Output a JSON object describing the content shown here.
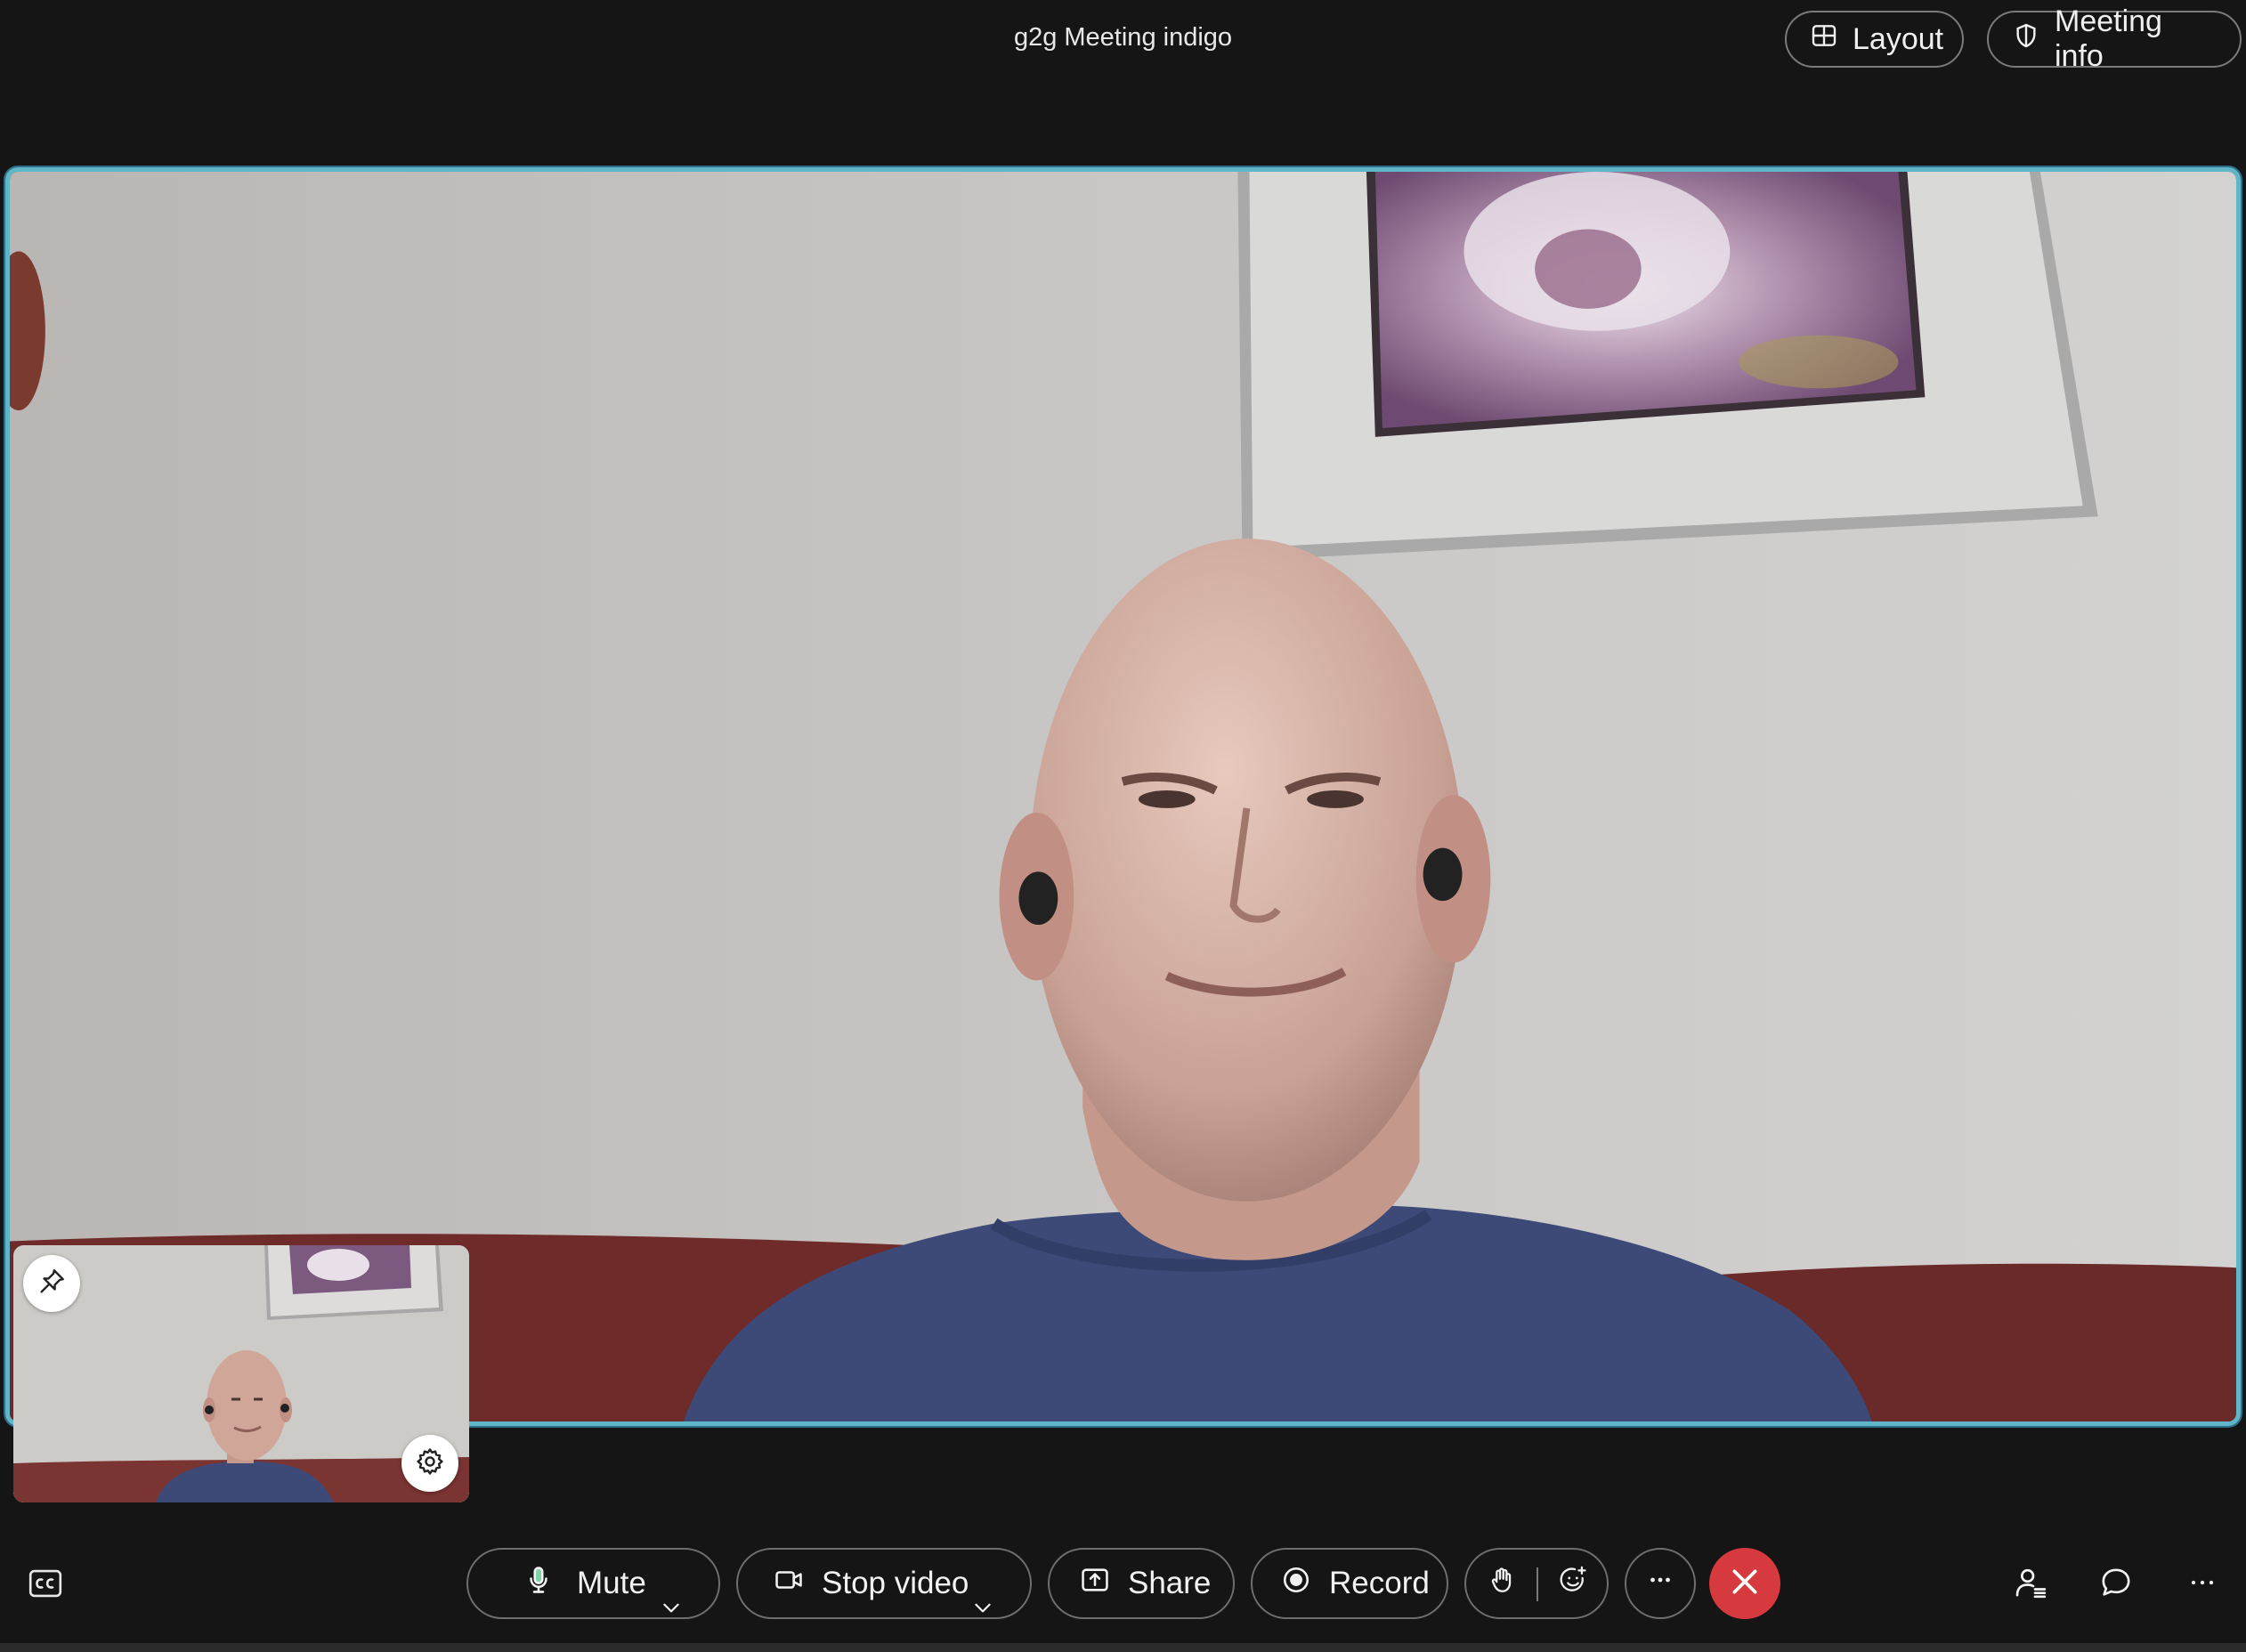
{
  "header": {
    "meeting_title": "g2g Meeting indigo",
    "layout_label": "Layout",
    "meeting_info_label": "Meeting info"
  },
  "main_video": {
    "active_speaker_border_color": "#5fb6c9"
  },
  "self_view": {
    "pin_icon": "pin-icon",
    "settings_icon": "gear-icon"
  },
  "toolbar": {
    "captions_icon": "closed-captions-icon",
    "mute_label": "Mute",
    "stop_video_label": "Stop video",
    "share_label": "Share",
    "record_label": "Record",
    "raise_hand_icon": "raise-hand-icon",
    "reactions_icon": "emoji-reaction-icon",
    "more_icon": "more-horizontal-icon",
    "end_call_icon": "close-icon",
    "participants_icon": "participants-icon",
    "chat_icon": "chat-bubble-icon",
    "overflow_icon": "more-horizontal-icon",
    "end_call_color": "#d63a3e",
    "mic_active_color": "#7ed3a8"
  }
}
